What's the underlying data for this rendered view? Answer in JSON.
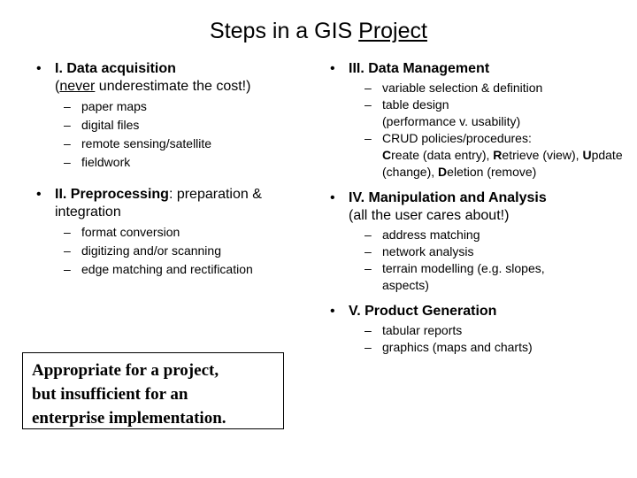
{
  "slide": {
    "title_before": "Steps in a GIS ",
    "title_underlined": "Project",
    "bullet_glyph": "•",
    "dash_glyph": "–"
  },
  "left_column": {
    "sections": [
      {
        "heading": "I.  Data acquisition",
        "subtitle_open": "(",
        "subtitle_underlined": "never",
        "subtitle_rest": " underestimate the cost!)",
        "items": [
          "paper maps",
          "digital files",
          "remote sensing/satellite",
          "fieldwork"
        ]
      },
      {
        "heading": "II. Preprocessing",
        "heading_tail": ": preparation & integration",
        "items": [
          "format conversion",
          "digitizing and/or scanning",
          "edge matching and rectification"
        ]
      }
    ]
  },
  "right_column": {
    "sections": [
      {
        "heading": "III.  Data Management",
        "items": [
          {
            "text": "variable selection & definition"
          },
          {
            "line1": "table design",
            "line2": "(performance v. usability)"
          },
          {
            "crud": true,
            "lead": "CRUD policies/procedures:",
            "parts": [
              {
                "bold": "C",
                "rest": "reate (data entry), "
              },
              {
                "bold": "R",
                "rest": "etrieve (view), "
              },
              {
                "bold": "U",
                "rest": "pdate (change), "
              },
              {
                "bold": "D",
                "rest": "eletion (remove)"
              }
            ]
          }
        ]
      },
      {
        "heading": "IV.  Manipulation and Analysis",
        "subtitle": "(all the user cares about!)",
        "items": [
          {
            "text": "address matching"
          },
          {
            "text": "network analysis"
          },
          {
            "line1": "terrain modelling (e.g. slopes,",
            "line2": "aspects)"
          }
        ]
      },
      {
        "heading": "V.  Product Generation",
        "items": [
          {
            "text": "tabular reports"
          },
          {
            "text": "graphics (maps and charts)"
          }
        ]
      }
    ]
  },
  "quote_box": {
    "line1": "Appropriate for a project,",
    "line2": "but insufficient for an",
    "line3": "enterprise implementation."
  }
}
